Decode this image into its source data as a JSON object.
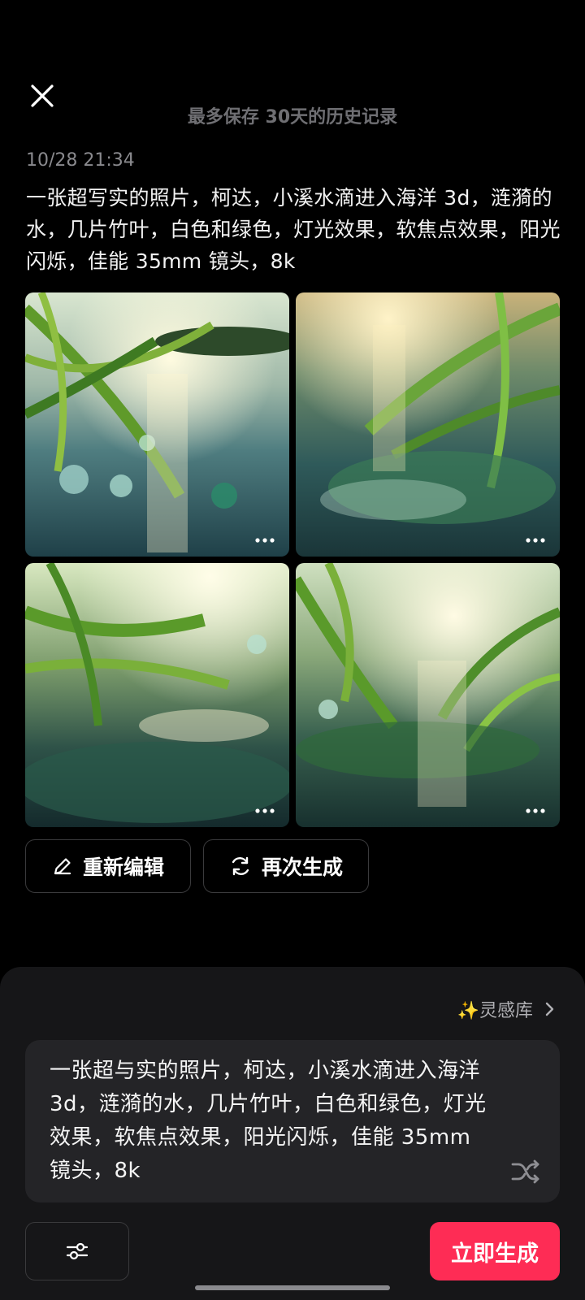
{
  "header": {
    "close_icon": "close-icon",
    "history_note": "最多保存 30天的历史记录"
  },
  "record": {
    "timestamp": "10/28 21:34",
    "prompt": "一张超写实的照片，柯达，小溪水滴进入海洋 3d，涟漪的水，几片竹叶，白色和绿色，灯光效果，软焦点效果，阳光闪烁，佳能 35mm 镜头，8k",
    "images": [
      {
        "name": "generated-image-1",
        "more_icon": "more-dots-icon"
      },
      {
        "name": "generated-image-2",
        "more_icon": "more-dots-icon"
      },
      {
        "name": "generated-image-3",
        "more_icon": "more-dots-icon"
      },
      {
        "name": "generated-image-4",
        "more_icon": "more-dots-icon"
      }
    ],
    "actions": {
      "edit_label": "重新编辑",
      "regenerate_label": "再次生成"
    }
  },
  "composer": {
    "inspiration_label": "✨灵感库",
    "input_text": "一张超与实的照片，柯达，小溪水滴进入海洋 3d，涟漪的水，几片竹叶，白色和绿色，灯光效果，软焦点效果，阳光闪烁，佳能 35mm 镜头，8k",
    "generate_label": "立即生成"
  },
  "colors": {
    "background": "#000000",
    "panel": "#161618",
    "accent": "#fe2c55"
  }
}
